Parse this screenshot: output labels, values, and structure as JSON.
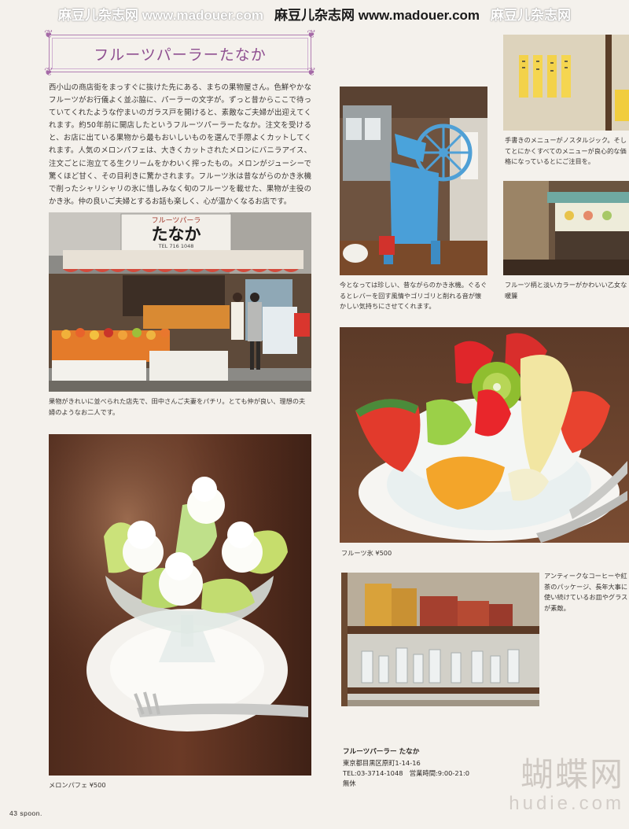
{
  "watermark": {
    "left": "麻豆儿杂志网 www.madouer.com",
    "center": "麻豆儿杂志网 www.madouer.com",
    "right": "麻豆儿杂志网"
  },
  "article": {
    "title": "フルーツパーラーたなか",
    "intro": "西小山の商店街をまっすぐに抜けた先にある、まちの果物屋さん。色鮮やかなフルーツがお行儀よく並ぶ脇に、パーラーの文字が。ずっと昔からここで待っていてくれたような佇まいのガラス戸を開けると、素敵なご夫婦が出迎えてくれます。約50年前に開店したというフルーツパーラーたなか。注文を受けると、お店に出ている果物から最もおいしいものを選んで手際よくカットしてくれます。人気のメロンパフェは、大きくカットされたメロンにバニラアイス、注文ごとに泡立てる生クリームをかわいく搾ったもの。メロンがジューシーで驚くほど甘く、その目利きに驚かされます。フルーツ氷は昔ながらのかき氷機で削ったシャリシャリの氷に惜しみなく旬のフルーツを載せた、果物が主役のかき氷。仲の良いご夫婦とするお話も楽しく、心が温かくなるお店です。"
  },
  "sign": {
    "small": "フルーツパーラ",
    "big": "たなか",
    "tel": "TEL 716 1048"
  },
  "captions": {
    "storefront": "果物がきれいに並べられた店先で、田中さんご夫妻をパチリ。とても仲が良い、理想の夫婦のようなお二人です。",
    "ice_machine": "今となっては珍しい、昔ながらのかき氷機。ぐるぐるとレバーを回す風情やゴリゴリと削れる音が懐かしい気持ちにさせてくれます。",
    "menu": "手書きのメニューがノスタルジック。そしてとにかくすべてのメニューが良心的な価格になっているとにご注目を。",
    "curtain": "フルーツ柄と淡いカラーがかわいい乙女な暖簾",
    "fruit_ice": "フルーツ氷 ¥500",
    "shelf": "アンティークなコーヒーや紅茶のパッケージ、長年大事に使い続けているお皿やグラスが素敵。",
    "melon_parfait": "メロンパフェ ¥500"
  },
  "shop_info": {
    "name": "フルーツパーラー たなか",
    "address": "東京都目黒区原町1-14-16",
    "phone_hours": "TEL:03-3714-1048　営業時間:9:00-21:0",
    "closed": "無休"
  },
  "footer": {
    "page": "43",
    "magazine": "spoon."
  },
  "brand_watermark": {
    "cn": "蝴蝶网",
    "en": "hudie.com"
  },
  "colors": {
    "title_accent": "#8e4e90",
    "frame_border": "#b27fb3",
    "page_bg": "#f4f1ec"
  }
}
